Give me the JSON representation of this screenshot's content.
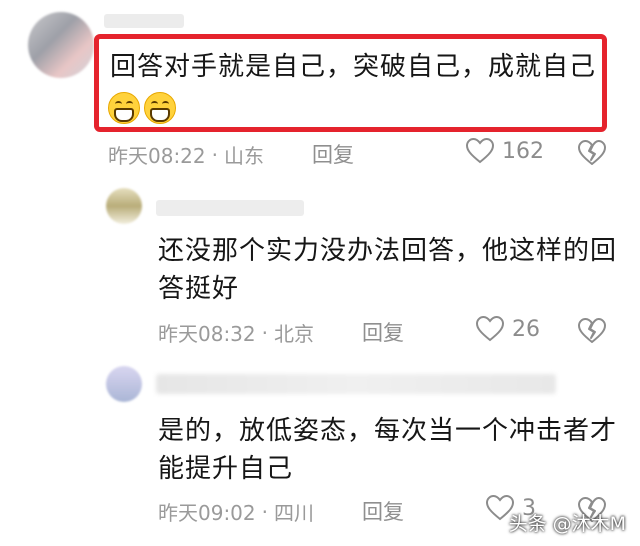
{
  "comments": [
    {
      "text": "回答对手就是自己，突破自己，成就自己",
      "emoji": [
        "grinning-emoji",
        "grinning-emoji"
      ],
      "time": "昨天08:22",
      "location": "山东",
      "reply_label": "回复",
      "likes": "162"
    },
    {
      "text_line1": "还没那个实力没办法回答，他这样的回",
      "text_line2": "答挺好",
      "time": "昨天08:32",
      "location": "北京",
      "reply_label": "回复",
      "likes": "26"
    },
    {
      "text_line1": "是的，放低姿态，每次当一个冲击者才",
      "text_line2": "能提升自己",
      "time": "昨天09:02",
      "location": "四川",
      "reply_label": "回复",
      "likes": "3"
    }
  ],
  "separator": "·",
  "watermark": "头条 @沐木M",
  "colors": {
    "highlight": "#e5232d",
    "meta": "#9a9a9a"
  }
}
